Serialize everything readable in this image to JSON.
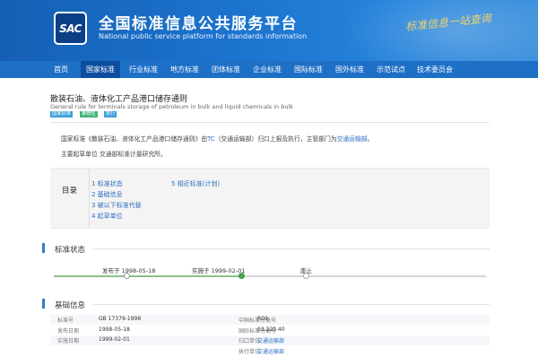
{
  "header": {
    "logo_text": "SAC",
    "title": "全国标准信息公共服务平台",
    "subtitle": "National public service platform  for standards information",
    "slogan": "标准信息一站查询",
    "colors": {
      "primary": "#1c74cf",
      "nav": "#1e6fc6",
      "nav_active": "#0d4f9e",
      "accent": "#2a7ed3"
    }
  },
  "nav": {
    "items": [
      {
        "label": "首页",
        "active": false
      },
      {
        "label": "国家标准",
        "active": true
      },
      {
        "label": "行业标准",
        "active": false
      },
      {
        "label": "地方标准",
        "active": false
      },
      {
        "label": "团体标准",
        "active": false
      },
      {
        "label": "企业标准",
        "active": false
      },
      {
        "label": "国际标准",
        "active": false
      },
      {
        "label": "国外标准",
        "active": false
      },
      {
        "label": "示范试点",
        "active": false
      },
      {
        "label": "技术委员会",
        "active": false
      }
    ]
  },
  "standard": {
    "title": "散装石油、液体化工产品港口储存通则",
    "title_en": "General rule for terminals storage of petroleum in bulk and liquid chemicals in bulk",
    "tags": [
      {
        "label": "国家标准",
        "color": "#3ca0d8"
      },
      {
        "label": "推荐性",
        "color": "#47b37a"
      },
      {
        "label": "现行",
        "color": "#3ca0d8"
      }
    ],
    "description_parts": [
      "国家标准《散装石油、液体化工产品港口储存通则》由",
      "TC",
      "（交通运输部）归口上报及执行，主管部门为",
      "交通运输部",
      "。"
    ],
    "drafting_parts": [
      "主要起草单位 ",
      "交通部标准计量研究所",
      "。"
    ]
  },
  "directory": {
    "label": "目录",
    "items": [
      "1  标准状态",
      "2  基础信息",
      "3  被以下标准代替",
      "4  起草单位",
      "5  相近标准(计划)"
    ]
  },
  "status_section": {
    "title": "标准状态",
    "milestones": [
      {
        "label": "发布于 1998-05-18",
        "state": "done"
      },
      {
        "label": "实施于 1999-02-01",
        "state": "current"
      },
      {
        "label": "废止",
        "state": "pending"
      }
    ]
  },
  "info_section": {
    "title": "基础信息",
    "rows": [
      {
        "k1": "标准号",
        "v1": "GB 17379-1998",
        "k2": "中国标准分类号",
        "v2": "R09",
        "v2_link": false
      },
      {
        "k1": "发布日期",
        "v1": "1998-05-18",
        "k2": "国际标准分类号",
        "v2": "03.220.40",
        "v2_link": false
      },
      {
        "k1": "实施日期",
        "v1": "1999-02-01",
        "k2": "归口单位",
        "v2": "交通运输部",
        "v2_link": true
      },
      {
        "k1": "",
        "v1": "",
        "k2": "执行单位",
        "v2": "交通运输部",
        "v2_link": true
      }
    ]
  }
}
